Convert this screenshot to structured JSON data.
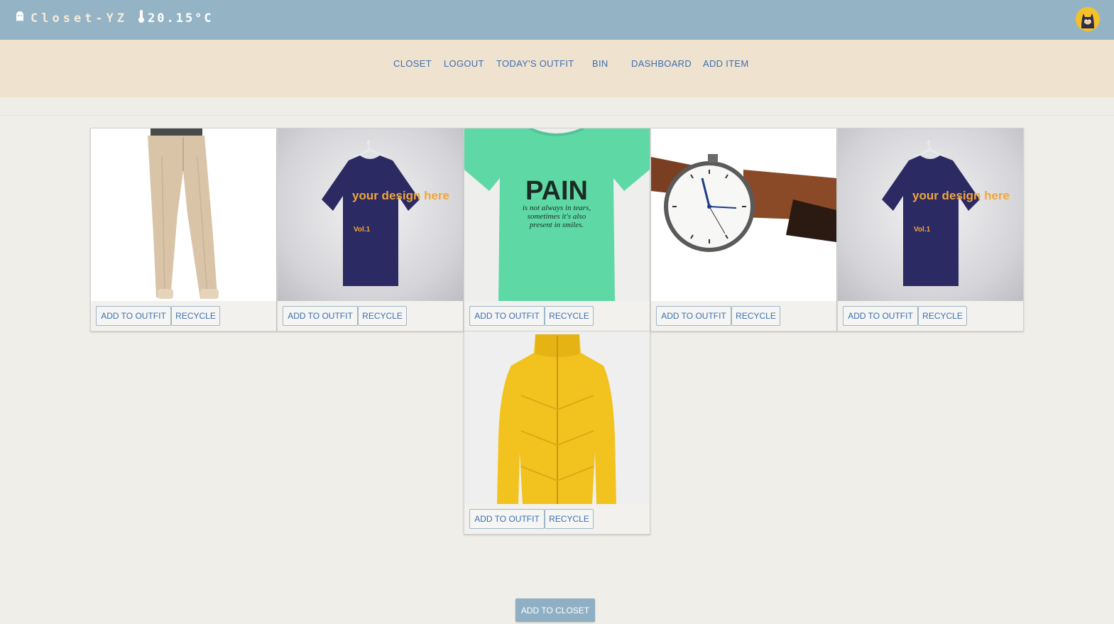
{
  "header": {
    "app_name": "Closet-YZ",
    "temperature": "20.15°C",
    "logo_icon": "ghost-icon",
    "temperature_icon": "thermometer-icon",
    "avatar_icon": "batman-avatar-icon",
    "background": "#94b4c6"
  },
  "nav": {
    "items": [
      {
        "label": "CLOSET"
      },
      {
        "label": "LOGOUT"
      },
      {
        "label": "TODAY'S OUTFIT"
      },
      {
        "label": "BIN"
      },
      {
        "label": "DASHBOARD"
      },
      {
        "label": "ADD ITEM"
      }
    ],
    "background": "#efe2ce",
    "link_color": "#3d6fb3"
  },
  "items": [
    {
      "image": "beige-trousers",
      "add_label": "ADD TO OUTFIT",
      "recycle_label": "RECYCLE"
    },
    {
      "image": "navy-tshirt-your-design-here",
      "add_label": "ADD TO OUTFIT",
      "recycle_label": "RECYCLE",
      "print": "your design here",
      "print_sub": "Vol.1"
    },
    {
      "image": "mint-tshirt-pain",
      "add_label": "ADD TO OUTFIT",
      "recycle_label": "RECYCLE",
      "print": "PAIN",
      "print_lines": [
        "is not always in tears,",
        "sometimes it's also",
        "present in smiles."
      ]
    },
    {
      "image": "leather-wristwatch",
      "add_label": "ADD TO OUTFIT",
      "recycle_label": "RECYCLE"
    },
    {
      "image": "navy-tshirt-your-design-here",
      "add_label": "ADD TO OUTFIT",
      "recycle_label": "RECYCLE",
      "print": "your design here",
      "print_sub": "Vol.1"
    },
    {
      "image": "yellow-puffer-jacket",
      "add_label": "ADD TO OUTFIT",
      "recycle_label": "RECYCLE"
    }
  ],
  "footer": {
    "add_to_closet_label": "ADD TO CLOSET",
    "button_color": "#8fb0c4"
  }
}
